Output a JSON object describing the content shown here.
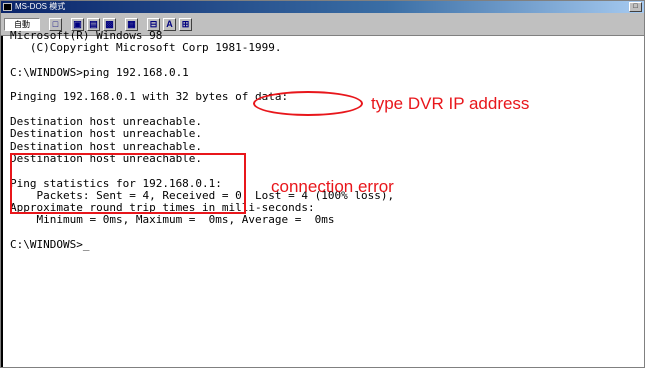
{
  "window": {
    "title": "MS-DOS 模式",
    "maximize_glyph": "□"
  },
  "toolbar": {
    "font_size": "自動",
    "buttons": [
      {
        "name": "mark-icon",
        "glyph": "□"
      },
      {
        "name": "copy-icon",
        "glyph": "▣"
      },
      {
        "name": "paste-icon",
        "glyph": "▤"
      },
      {
        "name": "fullscreen-icon",
        "glyph": "▩"
      },
      {
        "name": "properties-icon",
        "glyph": "▦"
      },
      {
        "name": "background-icon",
        "glyph": "⊟"
      },
      {
        "name": "font-icon",
        "glyph": "A"
      },
      {
        "name": "keyboard-icon",
        "glyph": "⊞"
      }
    ]
  },
  "console": {
    "lines": [
      "Microsoft(R) Windows 98",
      "   (C)Copyright Microsoft Corp 1981-1999.",
      "",
      "C:\\WINDOWS>ping 192.168.0.1",
      "",
      "Pinging 192.168.0.1 with 32 bytes of data:",
      "",
      "Destination host unreachable.",
      "Destination host unreachable.",
      "Destination host unreachable.",
      "Destination host unreachable.",
      "",
      "Ping statistics for 192.168.0.1:",
      "    Packets: Sent = 4, Received = 0, Lost = 4 (100% loss),",
      "Approximate round trip times in milli-seconds:",
      "    Minimum = 0ms, Maximum =  0ms, Average =  0ms",
      "",
      "C:\\WINDOWS>_"
    ]
  },
  "annotations": {
    "ip_label": "type DVR IP address",
    "error_label": "connection error"
  },
  "colors": {
    "annotation_red": "#e8161b",
    "titlebar_blue": "#0a246a"
  }
}
